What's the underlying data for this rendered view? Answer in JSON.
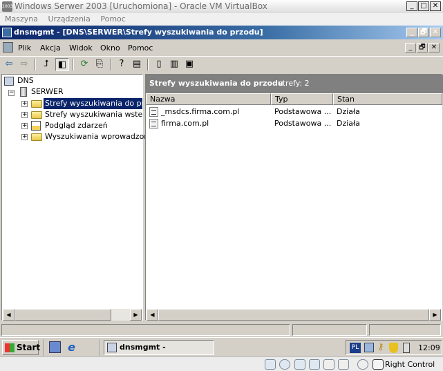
{
  "vbox": {
    "title": "Windows Serwer 2003 [Uruchomiona] - Oracle VM VirtualBox",
    "menu": [
      "Maszyna",
      "Urządzenia",
      "Pomoc"
    ],
    "window_buttons": [
      "_",
      "□",
      "✕"
    ],
    "status_right": "Right Control"
  },
  "mmc": {
    "title": "dnsmgmt - [DNS\\SERWER\\Strefy wyszukiwania do przodu]",
    "menu": [
      "Plik",
      "Akcja",
      "Widok",
      "Okno",
      "Pomoc"
    ],
    "window_buttons": [
      "_",
      "🗗",
      "✕"
    ]
  },
  "tree": {
    "root": "DNS",
    "server": "SERWER",
    "items": [
      {
        "label": "Strefy wyszukiwania do przodu",
        "selected": true,
        "icon": "folder-icon"
      },
      {
        "label": "Strefy wyszukiwania wstecznego",
        "selected": false,
        "icon": "folder-icon"
      },
      {
        "label": "Podgląd zdarzeń",
        "selected": false,
        "icon": "event-viewer-icon"
      },
      {
        "label": "Wyszukiwania wprowadzone",
        "selected": false,
        "icon": "folder-icon"
      }
    ]
  },
  "list": {
    "header_title": "Strefy wyszukiwania do przodu",
    "header_count": "strefy: 2",
    "columns": [
      "Nazwa",
      "Typ",
      "Stan"
    ],
    "rows": [
      {
        "name": "_msdcs.firma.com.pl",
        "type": "Podstawowa ...",
        "status": "Działa"
      },
      {
        "name": "firma.com.pl",
        "type": "Podstawowa ...",
        "status": "Działa"
      }
    ]
  },
  "taskbar": {
    "start_label": "Start",
    "task_label": "dnsmgmt - [DNS\\SER...",
    "language": "PL",
    "clock": "12:09"
  }
}
